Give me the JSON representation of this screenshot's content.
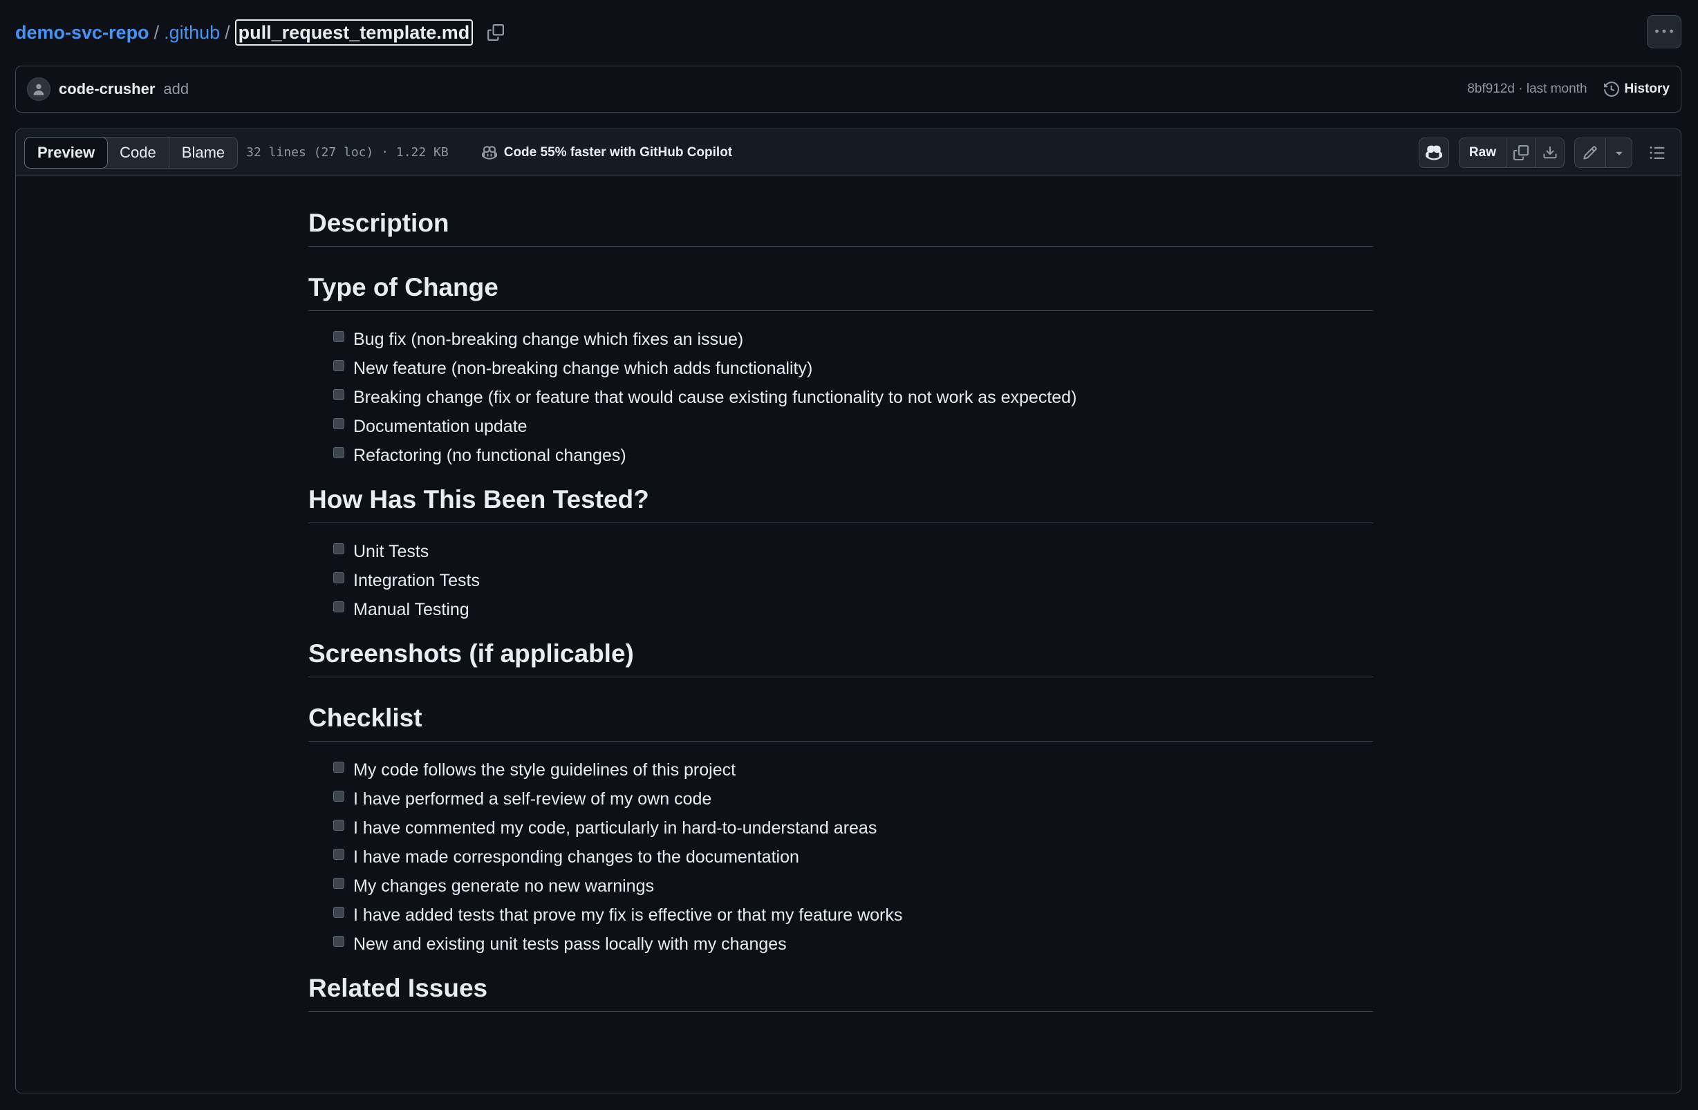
{
  "breadcrumb": {
    "repo": "demo-svc-repo",
    "folder": ".github",
    "separator": "/",
    "file": "pull_request_template.md"
  },
  "commit": {
    "author": "code-crusher",
    "message": "add",
    "sha_time": "8bf912d · last month",
    "history_label": "History"
  },
  "file_header": {
    "tabs": [
      "Preview",
      "Code",
      "Blame"
    ],
    "active_tab": "Preview",
    "info": "32 lines (27 loc) · 1.22 KB",
    "copilot_text": "Code 55% faster with GitHub Copilot",
    "raw_label": "Raw",
    "icons": [
      "copilot-icon",
      "copy-icon",
      "download-icon",
      "pencil-icon",
      "triangle-down-icon",
      "list-unordered-icon",
      "kebab-horizontal-icon",
      "history-icon"
    ]
  },
  "markdown": {
    "headings": {
      "description": "Description",
      "type_of_change": "Type of Change",
      "tested": "How Has This Been Tested?",
      "screenshots": "Screenshots (if applicable)",
      "checklist": "Checklist",
      "related": "Related Issues"
    },
    "type_of_change": [
      "Bug fix (non-breaking change which fixes an issue)",
      "New feature (non-breaking change which adds functionality)",
      "Breaking change (fix or feature that would cause existing functionality to not work as expected)",
      "Documentation update",
      "Refactoring (no functional changes)"
    ],
    "tested": [
      "Unit Tests",
      "Integration Tests",
      "Manual Testing"
    ],
    "checklist": [
      "My code follows the style guidelines of this project",
      "I have performed a self-review of my own code",
      "I have commented my code, particularly in hard-to-understand areas",
      "I have made corresponding changes to the documentation",
      "My changes generate no new warnings",
      "I have added tests that prove my fix is effective or that my feature works",
      "New and existing unit tests pass locally with my changes"
    ]
  }
}
